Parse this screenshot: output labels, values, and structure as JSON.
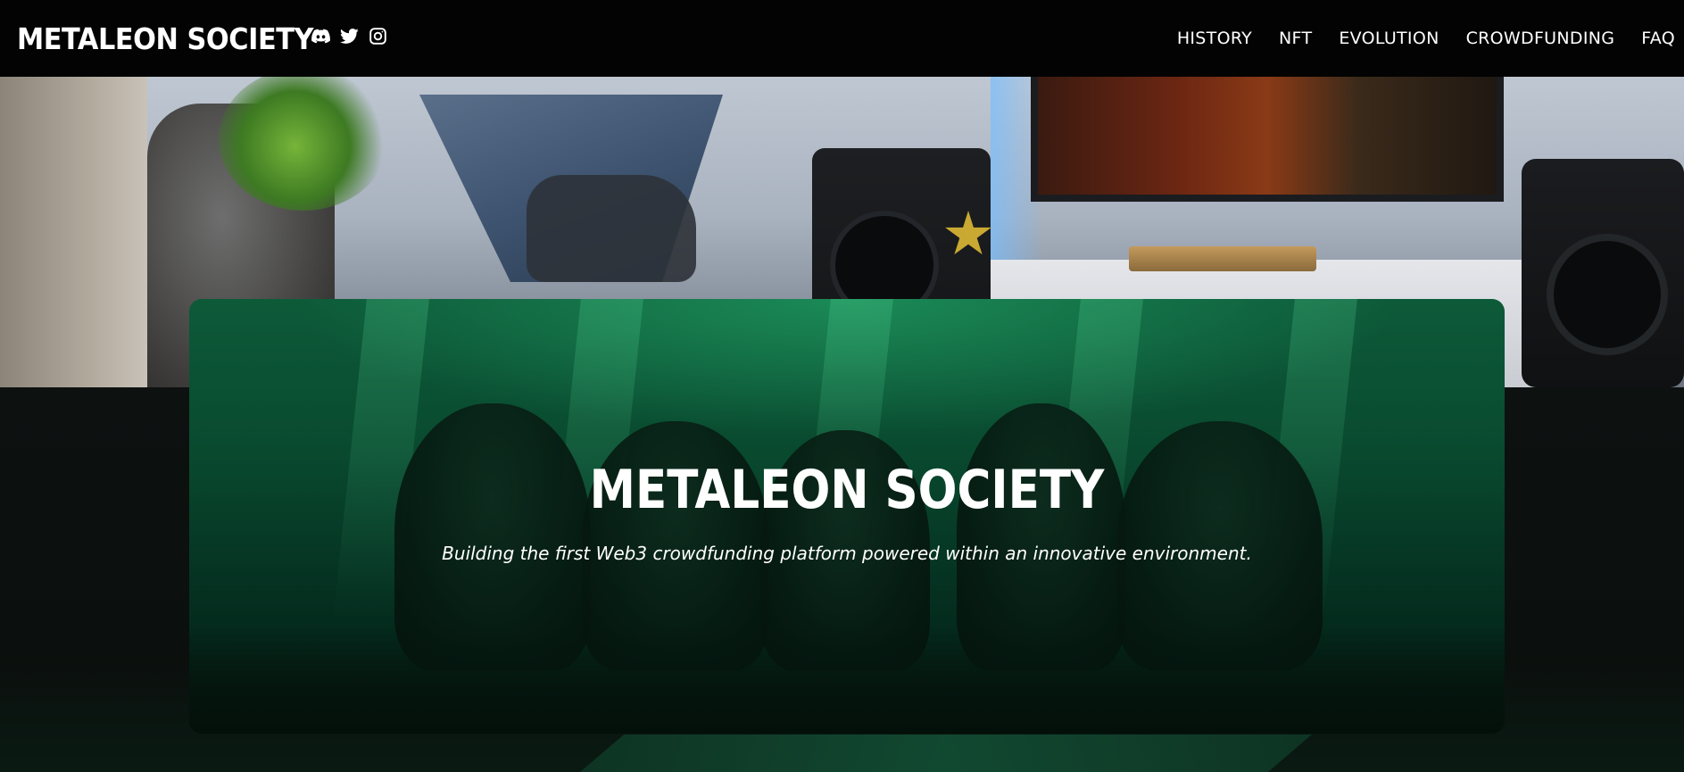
{
  "navbar": {
    "brand": "METALEON SOCIETY",
    "socials": [
      {
        "icon": "discord-icon",
        "label": "Discord"
      },
      {
        "icon": "twitter-icon",
        "label": "Twitter"
      },
      {
        "icon": "instagram-icon",
        "label": "Instagram"
      }
    ],
    "links": [
      "HISTORY",
      "NFT",
      "EVOLUTION",
      "CROWDFUNDING",
      "FAQ"
    ]
  },
  "hero": {
    "title": "METALEON SOCIETY",
    "subtitle": "Building the first Web3 crowdfunding platform powered within an innovative environment."
  },
  "colors": {
    "navbar_bg": "#030303",
    "card_green": "#0d5a39",
    "page_bg": "#0c100e",
    "text": "#ffffff"
  }
}
